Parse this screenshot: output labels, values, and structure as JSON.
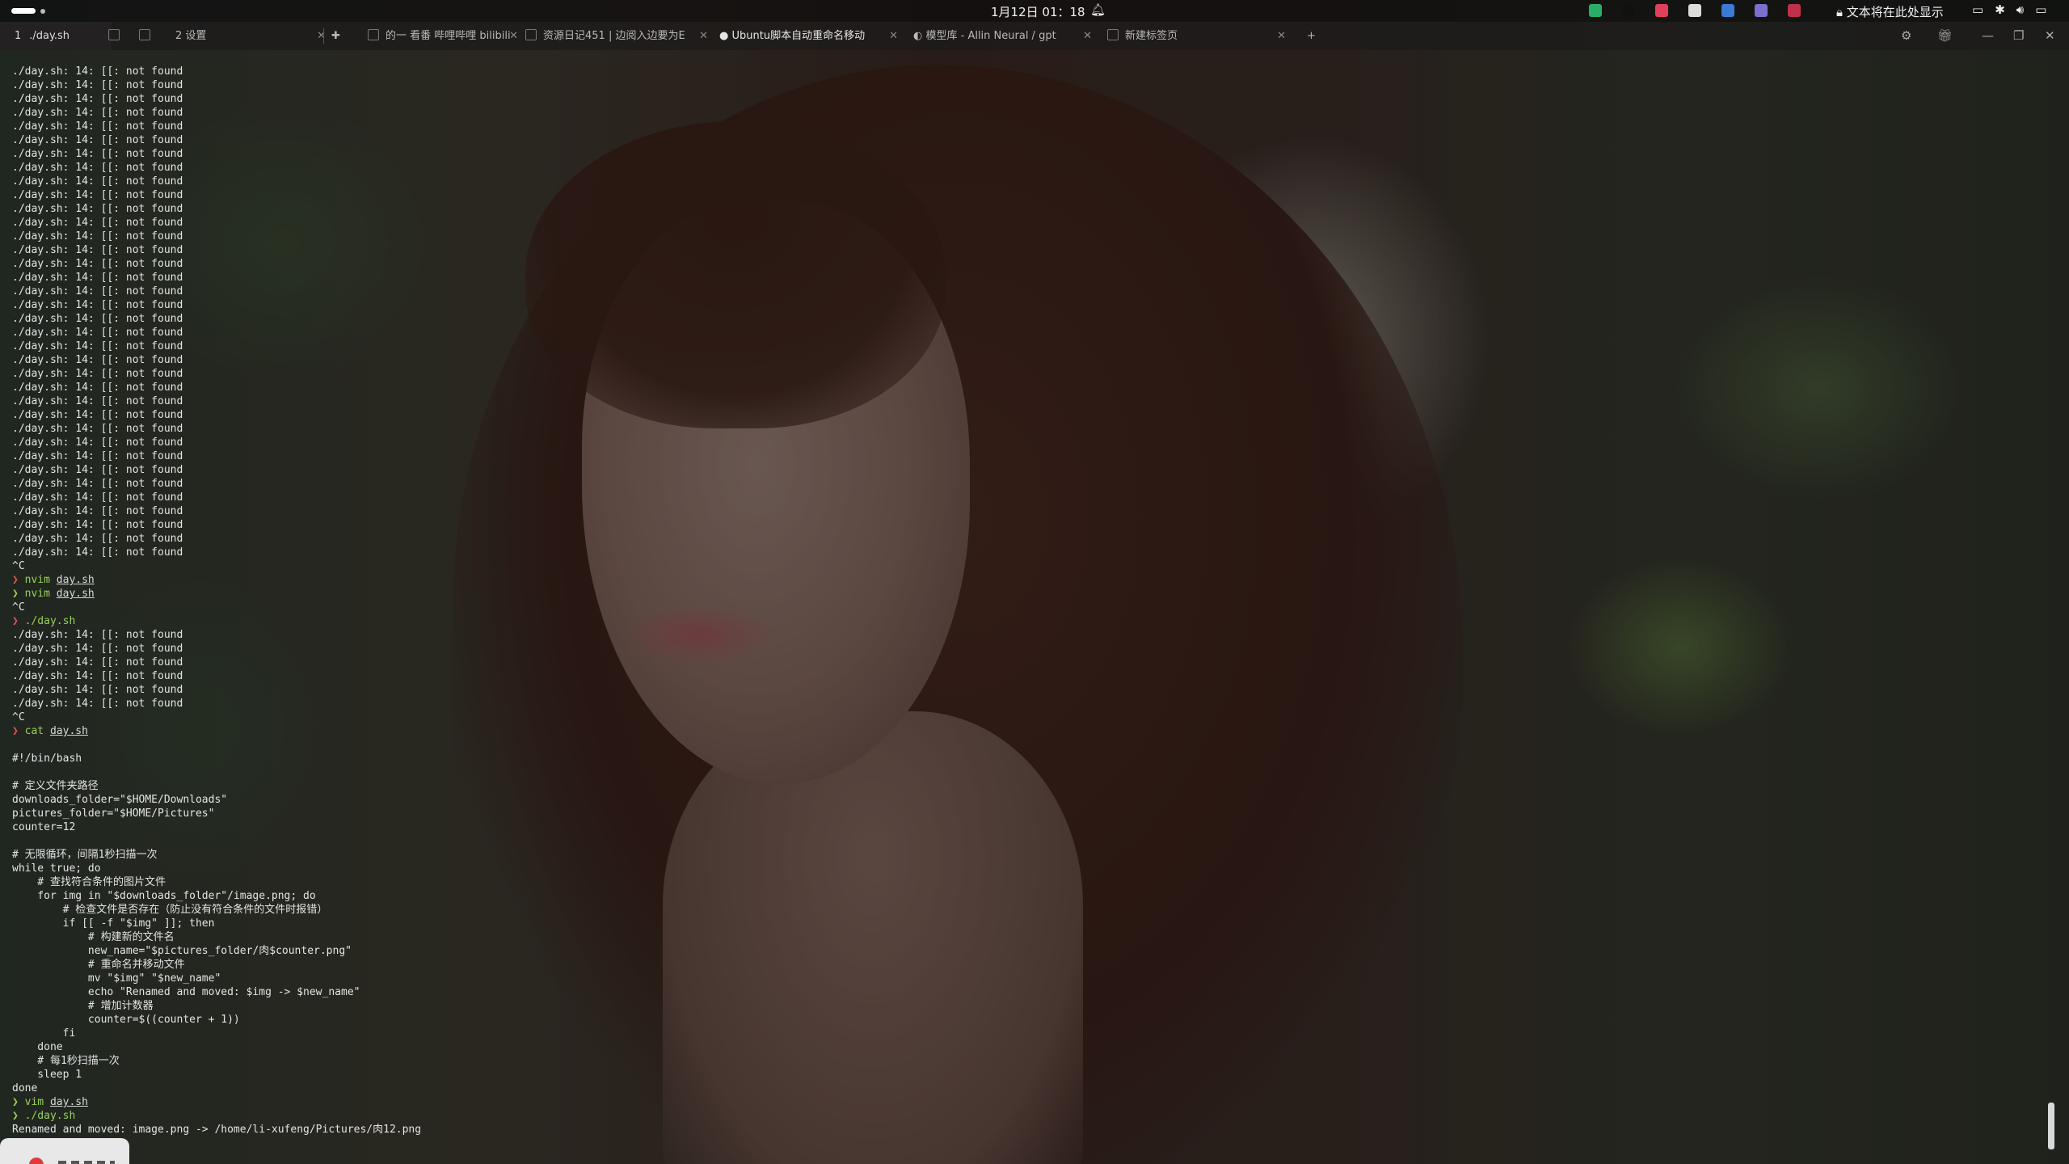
{
  "topbar": {
    "clock": "1月12日  01：18",
    "tray_text": "文本将在此处显示",
    "tray_icon_colors": [
      "#2aae67",
      "#111111",
      "#e0405c",
      "#dddddd",
      "#3b7bd6",
      "#7b6fcf",
      "#c0304a"
    ]
  },
  "tabs": {
    "terminal": {
      "num": "1",
      "title": "./day.sh"
    },
    "items": [
      {
        "label": "2 设置",
        "active": false
      },
      {
        "label": "",
        "active": false
      },
      {
        "label": "的一  看番 哔哩哔哩 bilibili",
        "active": false
      },
      {
        "label": "资源日记451 | 边阅入边要为E",
        "active": false
      },
      {
        "label": "Ubuntu脚本自动重命名移动",
        "active": true
      },
      {
        "label": "模型库 - Allin Neural / gpt",
        "active": false
      },
      {
        "label": "新建标签页",
        "active": false
      }
    ],
    "new_tab": "+"
  },
  "terminal": {
    "not_found_line": "./day.sh: 14: [[: not found",
    "ctrl_c": "^C",
    "prompt_symbol": "❯",
    "cmd_nvim": "nvim",
    "cmd_cat": "cat",
    "cmd_vim": "vim",
    "arg_file": "day.sh",
    "cmd_run": "./day.sh",
    "script": [
      "",
      "#!/bin/bash",
      "",
      "# 定义文件夹路径",
      "downloads_folder=\"$HOME/Downloads\"",
      "pictures_folder=\"$HOME/Pictures\"",
      "counter=12",
      "",
      "# 无限循环，间隔1秒扫描一次",
      "while true; do",
      "    # 查找符合条件的图片文件",
      "    for img in \"$downloads_folder\"/image.png; do",
      "        # 检查文件是否存在（防止没有符合条件的文件时报错）",
      "        if [[ -f \"$img\" ]]; then",
      "            # 构建新的文件名",
      "            new_name=\"$pictures_folder/肉$counter.png\"",
      "            # 重命名并移动文件",
      "            mv \"$img\" \"$new_name\"",
      "            echo \"Renamed and moved: $img -> $new_name\"",
      "            # 增加计数器",
      "            counter=$((counter + 1))",
      "        fi",
      "    done",
      "    # 每1秒扫描一次",
      "    sleep 1",
      "done"
    ],
    "final_output": "Renamed and moved: image.png -> /home/li-xufeng/Pictures/肉12.png"
  }
}
